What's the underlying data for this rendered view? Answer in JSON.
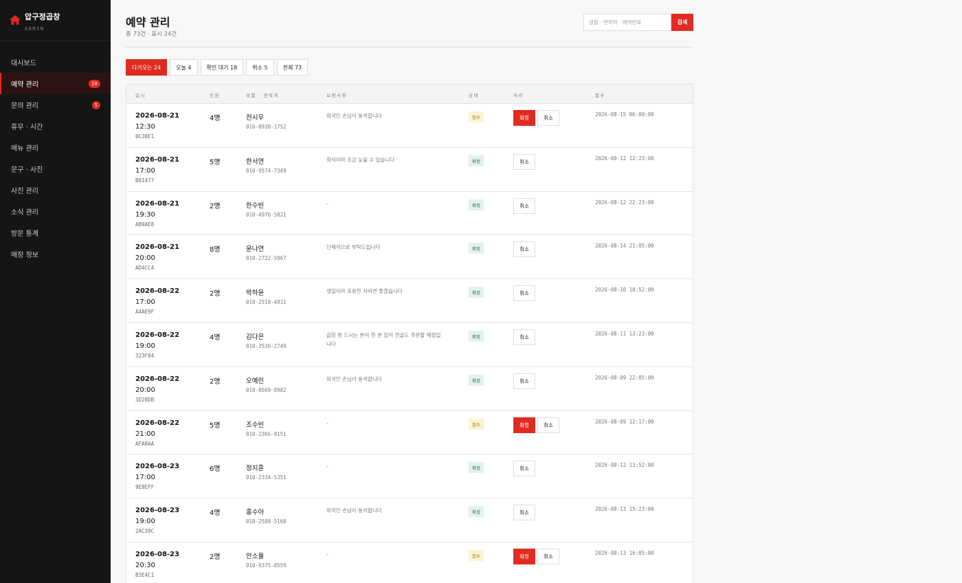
{
  "brand": {
    "name": "압구정곱창",
    "sub": "ADMIN",
    "icon": "house-icon",
    "accent": "#e12b20"
  },
  "sidebar": {
    "items": [
      {
        "label": "대시보드",
        "badge": null,
        "active": false
      },
      {
        "label": "예약 관리",
        "badge": "18",
        "active": true
      },
      {
        "label": "문의 관리",
        "badge": "5",
        "active": false
      },
      {
        "label": "휴무 · 시간",
        "badge": null,
        "active": false
      },
      {
        "label": "메뉴 관리",
        "badge": null,
        "active": false
      },
      {
        "label": "문구 · 사진",
        "badge": null,
        "active": false
      },
      {
        "label": "사진 관리",
        "badge": null,
        "active": false
      },
      {
        "label": "소식 관리",
        "badge": null,
        "active": false
      },
      {
        "label": "방문 통계",
        "badge": null,
        "active": false
      },
      {
        "label": "매장 정보",
        "badge": null,
        "active": false
      }
    ]
  },
  "header": {
    "title": "예약 관리",
    "subtitle": "총 73건 · 표시 24건",
    "search_placeholder": "성함 · 연락처 · 예약번호",
    "search_value": "",
    "search_button": "검색"
  },
  "tabs": [
    {
      "label": "다가오는 24",
      "active": true
    },
    {
      "label": "오늘 4",
      "active": false
    },
    {
      "label": "확인 대기 18",
      "active": false
    },
    {
      "label": "취소 5",
      "active": false
    },
    {
      "label": "전체 73",
      "active": false
    }
  ],
  "table": {
    "headers": {
      "datetime": "일시",
      "people": "인원",
      "contact": "성함 · 연락처",
      "note": "요청사항",
      "status": "상태",
      "action": "처리",
      "received": "접수"
    },
    "confirm_label": "확정",
    "cancel_label": "취소",
    "rows": [
      {
        "date": "2026-08-21",
        "time": "12:30",
        "id": "0C38E1",
        "people": "4명",
        "name": "전시우",
        "phone": "010-8938-1752",
        "note": "외국인 손님이 동석합니다",
        "status": "접수",
        "pending": true,
        "received": "2026-08-15 06:00:00"
      },
      {
        "date": "2026-08-21",
        "time": "17:00",
        "id": "B01477",
        "people": "5명",
        "name": "한서연",
        "phone": "010-9574-7349",
        "note": "회식이라 조금 늦을 수 있습니다",
        "status": "확정",
        "pending": false,
        "received": "2026-08-12 12:23:00"
      },
      {
        "date": "2026-08-21",
        "time": "19:30",
        "id": "AB9AE8",
        "people": "2명",
        "name": "한수빈",
        "phone": "010-4976-5821",
        "note": "-",
        "status": "확정",
        "pending": false,
        "received": "2026-08-12 22:23:00"
      },
      {
        "date": "2026-08-21",
        "time": "20:00",
        "id": "AD4CC4",
        "people": "8명",
        "name": "윤나연",
        "phone": "010-2722-5967",
        "note": "단체석으로 부탁드립니다",
        "status": "확정",
        "pending": false,
        "received": "2026-08-14 21:05:00"
      },
      {
        "date": "2026-08-22",
        "time": "17:00",
        "id": "A4AE9F",
        "people": "2명",
        "name": "박하윤",
        "phone": "010-2518-4911",
        "note": "생일이라 조용한 자리면 좋겠습니다",
        "status": "확정",
        "pending": false,
        "received": "2026-08-10 10:52:00"
      },
      {
        "date": "2026-08-22",
        "time": "19:00",
        "id": "323F84",
        "people": "4명",
        "name": "김다은",
        "phone": "010-3536-2749",
        "note": "곱창 못 드시는 분이 한 분 있어 전골도 주문할 예정입니다",
        "status": "확정",
        "pending": false,
        "received": "2026-08-11 13:23:00"
      },
      {
        "date": "2026-08-22",
        "time": "20:00",
        "id": "3D28DB",
        "people": "2명",
        "name": "오예린",
        "phone": "010-8669-8982",
        "note": "외국인 손님이 동석합니다",
        "status": "확정",
        "pending": false,
        "received": "2026-08-09 22:05:00"
      },
      {
        "date": "2026-08-22",
        "time": "21:00",
        "id": "AFA8AA",
        "people": "5명",
        "name": "조수빈",
        "phone": "010-2366-8151",
        "note": "-",
        "status": "접수",
        "pending": true,
        "received": "2026-08-09 12:17:00"
      },
      {
        "date": "2026-08-23",
        "time": "17:00",
        "id": "9E8EFF",
        "people": "6명",
        "name": "정지훈",
        "phone": "010-2334-5351",
        "note": "-",
        "status": "확정",
        "pending": false,
        "received": "2026-08-12 13:52:00"
      },
      {
        "date": "2026-08-23",
        "time": "19:00",
        "id": "2AC39C",
        "people": "4명",
        "name": "홍수아",
        "phone": "010-2588-5168",
        "note": "외국인 손님이 동석합니다",
        "status": "확정",
        "pending": false,
        "received": "2026-08-13 15:23:00"
      },
      {
        "date": "2026-08-23",
        "time": "20:30",
        "id": "B3E4C1",
        "people": "2명",
        "name": "안소율",
        "phone": "010-9375-8559",
        "note": "-",
        "status": "접수",
        "pending": true,
        "received": "2026-08-13 16:05:00"
      }
    ]
  }
}
